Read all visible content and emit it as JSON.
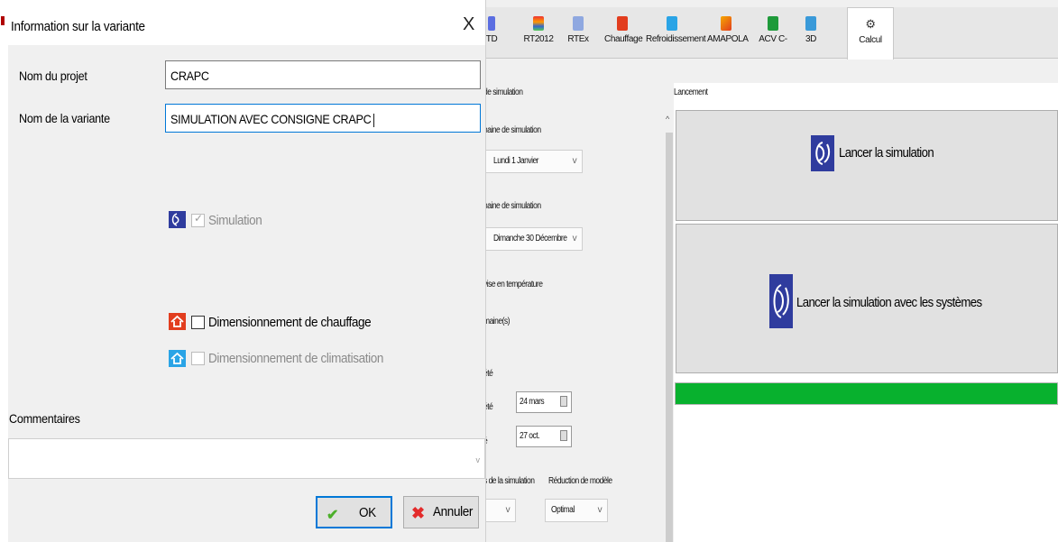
{
  "dialog": {
    "title": "Information sur la variante",
    "close_glyph": "X",
    "project_label": "Nom du projet",
    "project_value": "CRAPC",
    "variant_label": "Nom de la variante",
    "variant_value": "SIMULATION AVEC CONSIGNE CRAPC",
    "options": {
      "simulation": {
        "label": "Simulation",
        "checked": true,
        "enabled": false
      },
      "heating": {
        "label": "Dimensionnement de chauffage",
        "checked": false,
        "enabled": true
      },
      "cooling": {
        "label": "Dimensionnement de climatisation",
        "checked": false,
        "enabled": false
      }
    },
    "comments_label": "Commentaires",
    "ok_label": "OK",
    "cancel_label": "Annuler"
  },
  "ribbon": {
    "tabs": [
      {
        "label": "TD",
        "icon": "td-icon"
      },
      {
        "label": "RT2012",
        "icon": "rt2012-icon"
      },
      {
        "label": "RTEx",
        "icon": "rtex-icon"
      },
      {
        "label": "Chauffage",
        "icon": "heating-icon"
      },
      {
        "label": "Refroidissement",
        "icon": "cooling-icon"
      },
      {
        "label": "AMAPOLA",
        "icon": "amapola-icon"
      },
      {
        "label": "ACV C-",
        "icon": "acv-icon"
      },
      {
        "label": "3D",
        "icon": "3d-icon"
      },
      {
        "label": "Calcul",
        "icon": "gears-icon",
        "active": true
      }
    ]
  },
  "simulation": {
    "section_label": "de simulation",
    "start_week_label": "naine de simulation",
    "start_week_value": "Lundi 1 Janvier",
    "end_week_label": "naine de simulation",
    "end_week_value": "Dimanche 30 Décembre",
    "warmup_label": "vise en température",
    "weeks_label": "maine(s)",
    "summer_label": "été",
    "summer_start_label": "été",
    "summer_start_value": "24 mars",
    "summer_end_label": "é",
    "summer_end_value": "27 oct.",
    "sim_type_label": "s de la simulation",
    "model_reduction_label": "Réduction de modèle",
    "model_reduction_value": "Optimal"
  },
  "launch": {
    "section_label": "Lancement",
    "run_button": "Lancer la simulation",
    "run_systems_button": "Lancer la simulation avec les systèmes",
    "progress": 1.0
  },
  "colors": {
    "progress_green": "#08b12e",
    "logo_blue": "#2f3c9e",
    "focus_blue": "#0078d7",
    "heating_red": "#e23d1e",
    "cooling_blue": "#2aa4e6"
  }
}
